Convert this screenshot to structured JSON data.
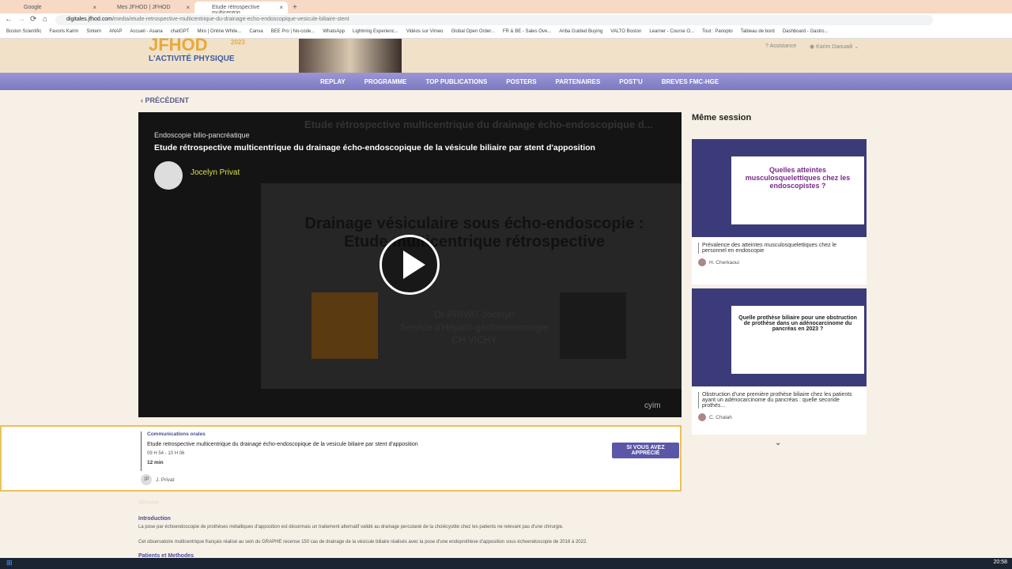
{
  "browser": {
    "tabs": [
      {
        "label": "Google"
      },
      {
        "label": "Mes JFHOD | JFHOD"
      },
      {
        "label": "Etude rétrospective multicentriq"
      }
    ],
    "url_domain": "digitales.jfhod.com",
    "url_path": "/media/etude-retrospective-multicentrique-du-drainage-echo-endoscopique-vesicule-biliaire-stent",
    "bookmarks": [
      "Boston Scientific",
      "Favoris Karim",
      "Sintem",
      "ANAP",
      "Accueil - Asana",
      "chatGPT",
      "Miro | Online White...",
      "Canva",
      "BEE Pro | No-code...",
      "WhatsApp",
      "Lightning Experienc...",
      "Vidéos sur Vimeo",
      "Global Open Order...",
      "FR & BE - Sales Ove...",
      "Ariba Guided Buying",
      "VALTO Boston",
      "Learner - Course O...",
      "Tout : Panopto",
      "Tableau de bord",
      "Dashboard - Gastro..."
    ]
  },
  "header": {
    "logo_text": "L'ACTIVITÉ PHYSIQUE",
    "year": "2023",
    "assistance": "Assistance",
    "user": "Karim Daouadi"
  },
  "nav": [
    "REPLAY",
    "PROGRAMME",
    "TOP PUBLICATIONS",
    "POSTERS",
    "PARTENAIRES",
    "POST'U",
    "BREVES FMC-HGE"
  ],
  "prev": "PRÉCÉDENT",
  "video": {
    "category": "Endoscopie bilio-pancréatique",
    "title": "Etude rétrospective multicentrique du drainage écho-endoscopique de la vésicule biliaire par stent d'apposition",
    "speaker": "Jocelyn Privat",
    "bg_title": "Etude rétrospective multicentrique du drainage écho-endoscopique d...",
    "slide_title": "Drainage vésiculaire sous écho-endoscopie : Etude multicentrique rétrospective",
    "slide_author": "Dr PRIVAT Jocelyn",
    "slide_service": "Service d'Hépato-gastroentérologie",
    "slide_place": "CH VICHY",
    "brand": "cyim"
  },
  "side": {
    "title": "Même session",
    "cards": [
      {
        "title": "Prévalence des atteintes musculosquelettiques chez le personnel en endoscopie",
        "author": "H. Cherkaoui",
        "slide": "Quelles atteintes musculosquelettiques chez les endoscopistes ?"
      },
      {
        "title": "Obstruction d'une première prothèse biliaire chez les patients ayant un adénocarcinome du pancréas : quelle seconde prothès...",
        "author": "C. Chalah",
        "slide": "Quelle prothèse biliaire pour une obstruction de prothèse dans un adénocarcinome du pancréas en 2023 ?"
      }
    ]
  },
  "info": {
    "session": "Communications orales",
    "title": "Etude retrospective multicentrique du drainage écho-endoscopique de la vesicule biliaire par stent d'apposition",
    "time": "09 H 54 - 10 H 06",
    "duration": "12 min",
    "author_initials": "JP",
    "author": "J. Privat",
    "button": "SI VOUS AVEZ APPRÉCIÉ"
  },
  "abstract": {
    "label": "Résumé",
    "intro_h": "Introduction",
    "p1": "La pose par échoendoscopie de prothèses métalliques d'apposition est désormais un traitement alternatif validé au drainage percutané de la cholécystite chez les patients ne relevant pas d'une chirurgie.",
    "p2": "Cet observatoire multicentrique français réalisé au sein du GRAPHE recense 150 cas de drainage de la vésicule biliaire réalisés avec la pose d'une endoprothèse d'apposition sous échoendoscopie de 2016 à 2022.",
    "methods_h": "Patients et Methodes"
  },
  "clock": "20:58"
}
